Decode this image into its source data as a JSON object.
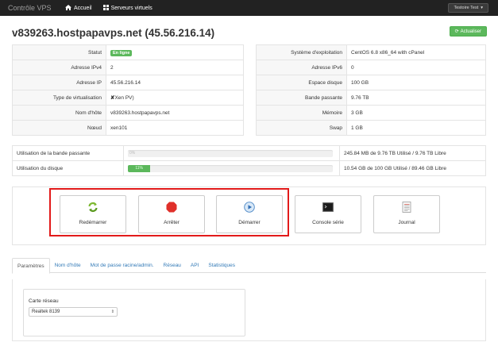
{
  "navbar": {
    "brand": "Contrôle VPS",
    "home_label": "Accueil",
    "servers_label": "Serveurs virtuels",
    "user_label": "Testoire Test"
  },
  "header": {
    "title": "v839263.hostpapavps.net (45.56.216.14)",
    "refresh_label": "Actualiser"
  },
  "info_left": [
    {
      "key": "Statut",
      "value": "En ligne",
      "badge": true
    },
    {
      "key": "Adresse IPv4",
      "value": "2"
    },
    {
      "key": "Adresse IP",
      "value": "45.56.216.14"
    },
    {
      "key": "Type de virtualisation",
      "value": "Xen PV)",
      "icon": "x-icon"
    },
    {
      "key": "Nom d'hôte",
      "value": "v839263.hostpapavps.net"
    },
    {
      "key": "Nœud",
      "value": "xen101"
    }
  ],
  "info_right": [
    {
      "key": "Système d'exploitation",
      "value": "CentOS 6.8 x86_64 with cPanel"
    },
    {
      "key": "Adresse IPv6",
      "value": "0"
    },
    {
      "key": "Espace disque",
      "value": "100 GB"
    },
    {
      "key": "Bande passante",
      "value": "9.76 TB"
    },
    {
      "key": "Mémoire",
      "value": "3 GB"
    },
    {
      "key": "Swap",
      "value": "1 GB"
    }
  ],
  "usage": [
    {
      "label": "Utilisation de la bande passante",
      "percent": 0,
      "bar_text": "0%",
      "summary": "245.84 MB de 9.76 TB Utilisé / 9.76 TB Libre"
    },
    {
      "label": "Utilisation du disque",
      "percent": 11,
      "bar_text": "11%",
      "summary": "10.54 GB de 100 GB Utilisé / 89.46 GB Libre"
    }
  ],
  "actions": [
    {
      "label": "Redémarrer",
      "icon": "restart-icon"
    },
    {
      "label": "Arrêter",
      "icon": "stop-icon"
    },
    {
      "label": "Démarrer",
      "icon": "play-icon"
    },
    {
      "label": "Console série",
      "icon": "console-icon"
    },
    {
      "label": "Journal",
      "icon": "journal-icon"
    }
  ],
  "tabs": [
    {
      "label": "Paramètres",
      "active": true
    },
    {
      "label": "Nom d'hôte"
    },
    {
      "label": "Mot de passe racine/admin."
    },
    {
      "label": "Réseau"
    },
    {
      "label": "API"
    },
    {
      "label": "Statistiques"
    }
  ],
  "settings": {
    "network_card_label": "Carte réseau",
    "network_card_value": "Realtek 8139"
  },
  "colors": {
    "navbar": "#222222",
    "success": "#5cb85c",
    "highlight": "#e21a1a",
    "link": "#337ab7"
  }
}
